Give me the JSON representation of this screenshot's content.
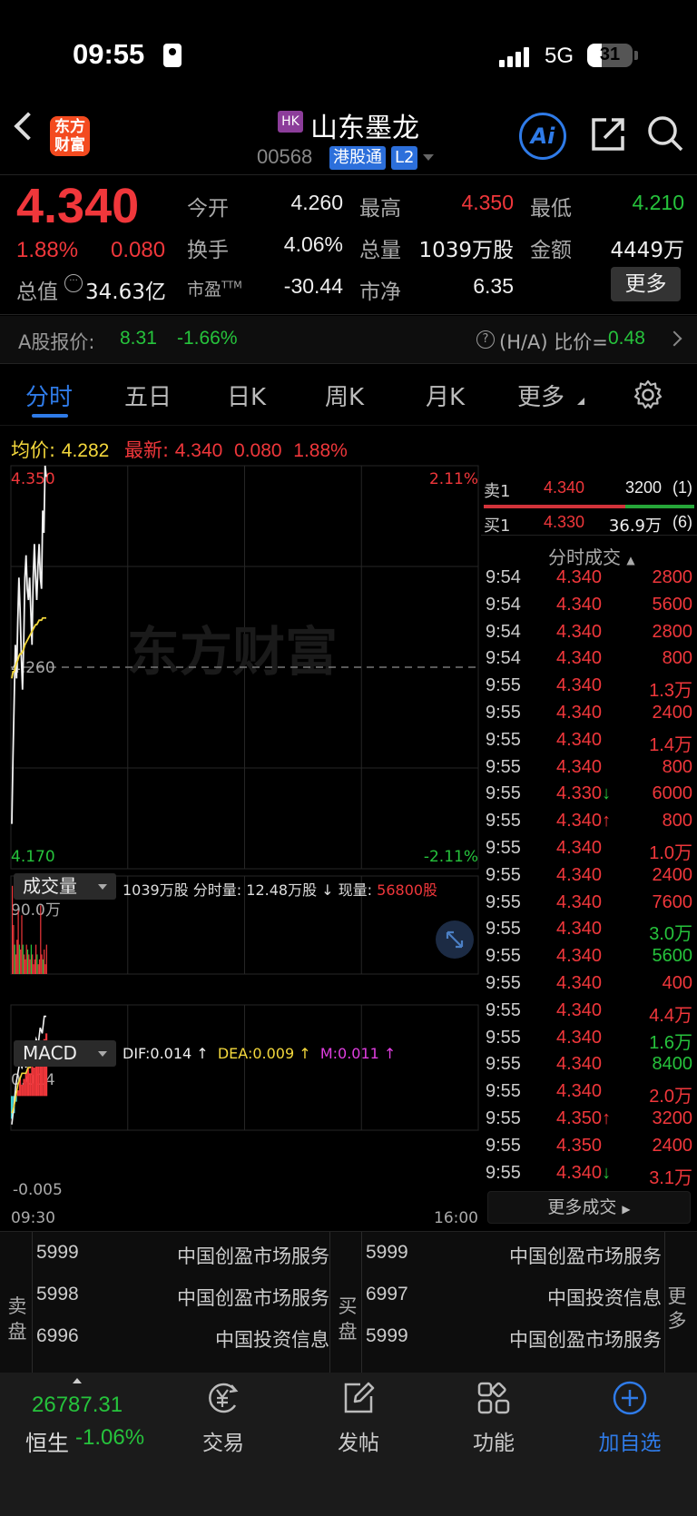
{
  "status": {
    "time": "09:55",
    "network": "5G",
    "battery": "31",
    "battery_level": 0.31
  },
  "header": {
    "logo_line1": "东方",
    "logo_line2": "财富",
    "market_badge": "HK",
    "name": "山东墨龙",
    "code": "00568",
    "connect_badge": "港股通",
    "level_badge": "L2",
    "ai_label": "Ai"
  },
  "quote": {
    "price": "4.340",
    "pct": "1.88%",
    "chg": "0.080",
    "mcap_label": "总值",
    "mcap": "34.63亿",
    "open_label": "今开",
    "open": "4.260",
    "high_label": "最高",
    "high": "4.350",
    "low_label": "最低",
    "low": "4.210",
    "turnover_label": "换手",
    "turnover": "4.06%",
    "volume_label": "总量",
    "volume": "1039万股",
    "amount_label": "金额",
    "amount": "4449万",
    "pe_label": "市盈",
    "pe_sup": "TTM",
    "pe": "-30.44",
    "pb_label": "市净",
    "pb": "6.35",
    "more_label": "更多"
  },
  "a_share": {
    "label": "A股报价:",
    "price": "8.31",
    "chg": "-1.66%",
    "ha_label": "(H/A) 比价=",
    "ha_value": "0.48"
  },
  "tabs": [
    "分时",
    "五日",
    "日K",
    "周K",
    "月K",
    "更多"
  ],
  "info": {
    "avg_label": "均价:",
    "avg": "4.282",
    "last_label": "最新:",
    "last": "4.340",
    "chg": "0.080",
    "pct": "1.88%"
  },
  "chart": {
    "y_max": "4.350",
    "y_min": "4.170",
    "y_mid": "4.260",
    "pct_max": "2.11%",
    "pct_min": "-2.11%",
    "time_start": "09:30",
    "time_end": "16:00",
    "watermark": "东方财富",
    "vol_axis_max": "90.0万",
    "macd_max": "0.014",
    "macd_min": "-0.005"
  },
  "chart_data": {
    "type": "line",
    "title": "",
    "xlabel": "",
    "ylabel": "",
    "ylim": [
      4.17,
      4.35
    ],
    "price_series": [
      4.19,
      4.22,
      4.245,
      4.27,
      4.255,
      4.28,
      4.3,
      4.285,
      4.265,
      4.25,
      4.27,
      4.3,
      4.31,
      4.295,
      4.29,
      4.3,
      4.285,
      4.27,
      4.3,
      4.315,
      4.3,
      4.29,
      4.305,
      4.315,
      4.3,
      4.295,
      4.33,
      4.32,
      4.35,
      4.345
    ],
    "avg_series": [
      4.255,
      4.258,
      4.258,
      4.26,
      4.262,
      4.263,
      4.265,
      4.266,
      4.266,
      4.267,
      4.268,
      4.27,
      4.271,
      4.272,
      4.273,
      4.274,
      4.275,
      4.276,
      4.277,
      4.278,
      4.279,
      4.279,
      4.28,
      4.281,
      4.281,
      4.281,
      4.282,
      4.282,
      4.282,
      4.282
    ],
    "volume_bars": [
      0.9,
      0.5,
      0.3,
      0.2,
      0.35,
      0.65,
      0.3,
      0.25,
      0.6,
      0.3,
      0.2,
      0.15,
      0.3,
      0.25,
      0.2,
      0.15,
      0.3,
      0.2,
      0.1,
      0.15,
      0.3,
      0.2,
      0.1,
      0.15,
      0.7,
      0.2,
      0.15,
      0.25,
      0.1,
      0.3
    ],
    "volume_up": [
      true,
      true,
      false,
      true,
      true,
      true,
      false,
      true,
      true,
      false,
      true,
      true,
      true,
      false,
      true,
      true,
      false,
      true,
      true,
      true,
      true,
      false,
      true,
      true,
      true,
      true,
      false,
      true,
      true,
      true
    ],
    "macd_bars": [
      -0.004,
      -0.003,
      -0.001,
      0.001,
      0.003,
      0.002,
      0.003,
      0.004,
      0.005,
      0.004,
      0.006,
      0.005,
      0.007,
      0.006,
      0.008,
      0.009,
      0.01,
      0.011
    ],
    "dif_series": [
      -0.005,
      -0.002,
      0.002,
      0.004,
      0.006,
      0.005,
      0.006,
      0.005,
      0.008,
      0.007,
      0.009,
      0.008,
      0.01,
      0.009,
      0.012,
      0.011,
      0.014,
      0.014
    ],
    "dea_series": [
      -0.003,
      -0.002,
      0.0,
      0.002,
      0.003,
      0.004,
      0.004,
      0.004,
      0.005,
      0.005,
      0.006,
      0.006,
      0.007,
      0.007,
      0.008,
      0.008,
      0.009,
      0.009
    ]
  },
  "volume_header": {
    "select": "成交量",
    "info1": "1039万股 分时量: 12.48万股 ↓ 现量: ",
    "now_vol": "56800股"
  },
  "macd_header": {
    "select": "MACD",
    "dif": "DIF:0.014 ↑",
    "dea": "DEA:0.009 ↑",
    "m": "M:0.011 ↑"
  },
  "order_book": {
    "sell_label": "卖1",
    "sell_price": "4.340",
    "sell_vol": "3200",
    "sell_count": "(1)",
    "buy_label": "买1",
    "buy_price": "4.330",
    "buy_vol": "36.9万",
    "buy_count": "(6)",
    "ticks_title": "分时成交"
  },
  "ticks": [
    {
      "t": "9:54",
      "p": "4.340",
      "v": "2800",
      "vc": "red"
    },
    {
      "t": "9:54",
      "p": "4.340",
      "v": "5600",
      "vc": "red"
    },
    {
      "t": "9:54",
      "p": "4.340",
      "v": "2800",
      "vc": "red"
    },
    {
      "t": "9:54",
      "p": "4.340",
      "v": "800",
      "vc": "red"
    },
    {
      "t": "9:55",
      "p": "4.340",
      "v": "1.3万",
      "vc": "red"
    },
    {
      "t": "9:55",
      "p": "4.340",
      "v": "2400",
      "vc": "red"
    },
    {
      "t": "9:55",
      "p": "4.340",
      "v": "1.4万",
      "vc": "red"
    },
    {
      "t": "9:55",
      "p": "4.340",
      "v": "800",
      "vc": "red"
    },
    {
      "t": "9:55",
      "p": "4.330↓",
      "v": "6000",
      "vc": "red"
    },
    {
      "t": "9:55",
      "p": "4.340↑",
      "v": "800",
      "vc": "red"
    },
    {
      "t": "9:55",
      "p": "4.340",
      "v": "1.0万",
      "vc": "red"
    },
    {
      "t": "9:55",
      "p": "4.340",
      "v": "2400",
      "vc": "red"
    },
    {
      "t": "9:55",
      "p": "4.340",
      "v": "7600",
      "vc": "red"
    },
    {
      "t": "9:55",
      "p": "4.340",
      "v": "3.0万",
      "vc": "green"
    },
    {
      "t": "9:55",
      "p": "4.340",
      "v": "5600",
      "vc": "green"
    },
    {
      "t": "9:55",
      "p": "4.340",
      "v": "400",
      "vc": "red"
    },
    {
      "t": "9:55",
      "p": "4.340",
      "v": "4.4万",
      "vc": "red"
    },
    {
      "t": "9:55",
      "p": "4.340",
      "v": "1.6万",
      "vc": "green"
    },
    {
      "t": "9:55",
      "p": "4.340",
      "v": "8400",
      "vc": "green"
    },
    {
      "t": "9:55",
      "p": "4.340",
      "v": "2.0万",
      "vc": "red"
    },
    {
      "t": "9:55",
      "p": "4.350↑",
      "v": "3200",
      "vc": "red"
    },
    {
      "t": "9:55",
      "p": "4.350",
      "v": "2400",
      "vc": "red"
    },
    {
      "t": "9:55",
      "p": "4.340↓",
      "v": "3.1万",
      "vc": "red"
    }
  ],
  "more_ticks": "更多成交",
  "brokers": {
    "sell_side": "卖盘",
    "buy_side": "买盘",
    "more": "更多",
    "sell": [
      {
        "id": "5999",
        "name": "中国创盈市场服务"
      },
      {
        "id": "5998",
        "name": "中国创盈市场服务"
      },
      {
        "id": "6996",
        "name": "中国投资信息"
      }
    ],
    "buy": [
      {
        "id": "5999",
        "name": "中国创盈市场服务"
      },
      {
        "id": "6997",
        "name": "中国投资信息"
      },
      {
        "id": "5999",
        "name": "中国创盈市场服务"
      }
    ]
  },
  "bottom_nav": {
    "index_value": "26787.31",
    "index_name": "恒生",
    "index_chg": "-1.06%",
    "items": [
      "交易",
      "发帖",
      "功能",
      "加自选"
    ]
  },
  "colors": {
    "up": "#f0373b",
    "down": "#26c33c",
    "accent": "#2f7be8",
    "avg_line": "#f4d83c"
  }
}
